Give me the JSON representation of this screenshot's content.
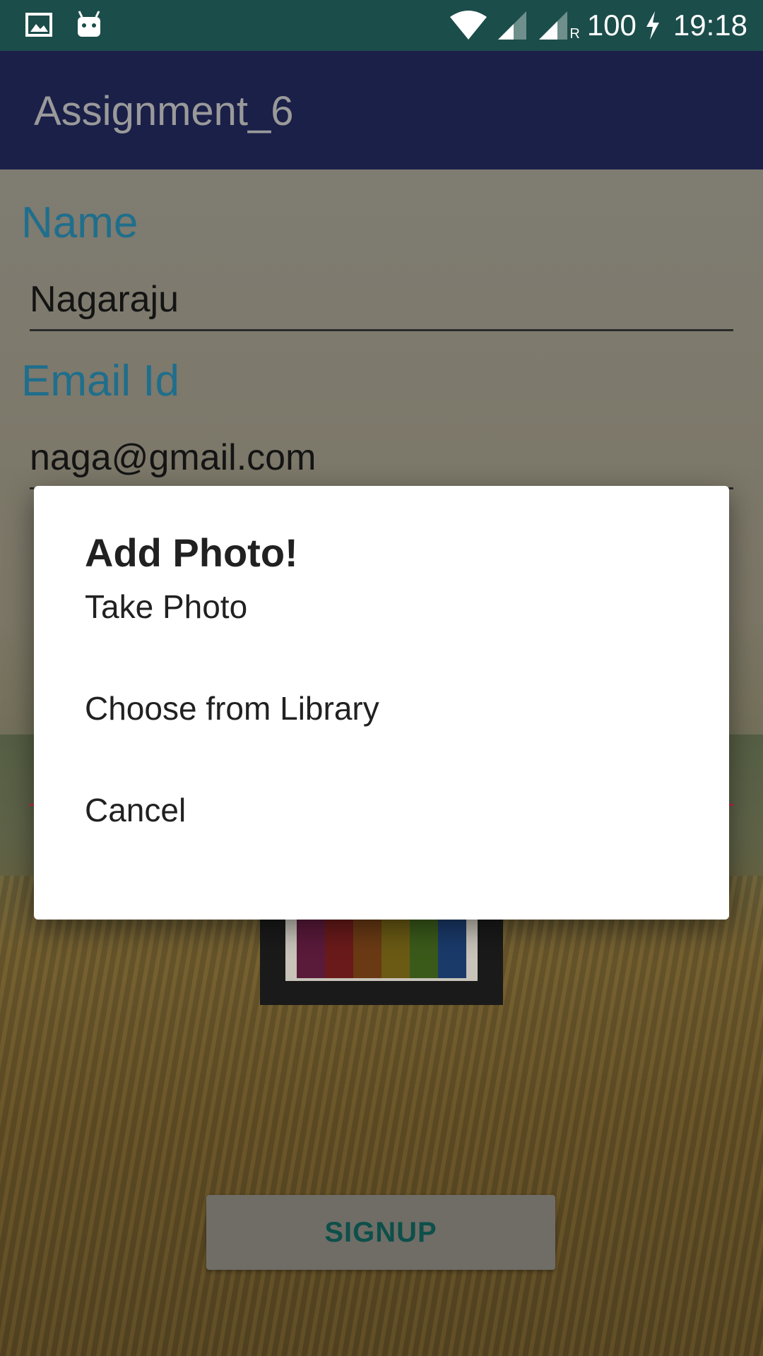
{
  "status_bar": {
    "battery": "100",
    "time": "19:18",
    "left_icons": [
      "image-icon",
      "android-icon"
    ],
    "right_icons": [
      "wifi-icon",
      "signal-icon",
      "signal-roaming-icon",
      "battery-charging-icon"
    ],
    "roaming_label": "R"
  },
  "app_bar": {
    "title": "Assignment_6"
  },
  "form": {
    "name_label": "Name",
    "name_value": "Nagaraju",
    "email_label": "Email Id",
    "email_value": "naga@gmail.com",
    "signup_label": "SIGNUP"
  },
  "dialog": {
    "title": "Add Photo!",
    "options": [
      "Take Photo",
      "Choose from Library",
      "Cancel"
    ]
  },
  "colors": {
    "status_bar": "#1b4d4a",
    "app_bar": "#1b2049",
    "field_label": "#1f6e8c",
    "field_error_line": "#c0284a",
    "dialog_bg": "#ffffff"
  }
}
